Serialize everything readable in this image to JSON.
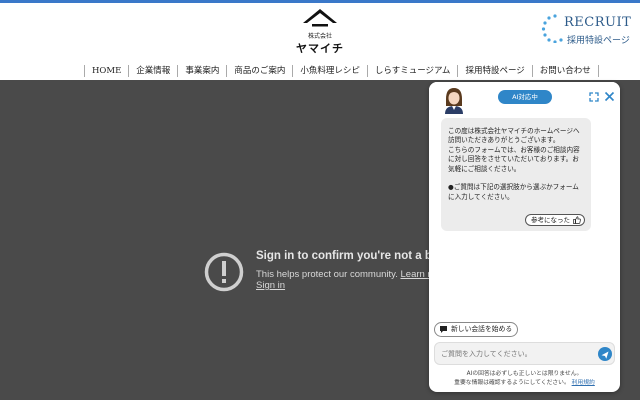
{
  "header": {
    "logo_small": "株式会社",
    "logo_name": "ヤマイチ",
    "recruit_en": "RECRUIT",
    "recruit_ja": "採用特設ページ",
    "brand_color": "#3a78c9"
  },
  "nav": {
    "items": [
      {
        "label": "HOME"
      },
      {
        "label": "企業情報"
      },
      {
        "label": "事業案内"
      },
      {
        "label": "商品のご案内"
      },
      {
        "label": "小魚料理レシピ"
      },
      {
        "label": "しらすミュージアム"
      },
      {
        "label": "採用特設ページ"
      },
      {
        "label": "お問い合わせ"
      }
    ]
  },
  "captcha": {
    "title": "Sign in to confirm you're not a bot",
    "line": "This helps protect our community. ",
    "learn_more": "Learn more",
    "sign_in": "Sign in",
    "icon": "alert-circle-icon"
  },
  "chat": {
    "badge": "AI対応中",
    "message": "この度は株式会社ヤマイチのホームページへ訪問いただきありがとうございます。\nこちらのフォームでは、お客様のご相談内容に対し回答をさせていただいております。お気軽にご相談ください。\n\n●ご質問は下記の選択肢から選ぶかフォームに入力してください。",
    "helpful_label": "参考になった",
    "new_chat_label": "新しい会話を始める",
    "input_placeholder": "ご質問を入力してください。",
    "disclaimer_line1": "AIの回答は必ずしも正しいとは限りません。",
    "disclaimer_line2": "重要な情報は確認するようにしてください。",
    "terms_label": "利用規約",
    "accent_color": "#2f86c8"
  }
}
